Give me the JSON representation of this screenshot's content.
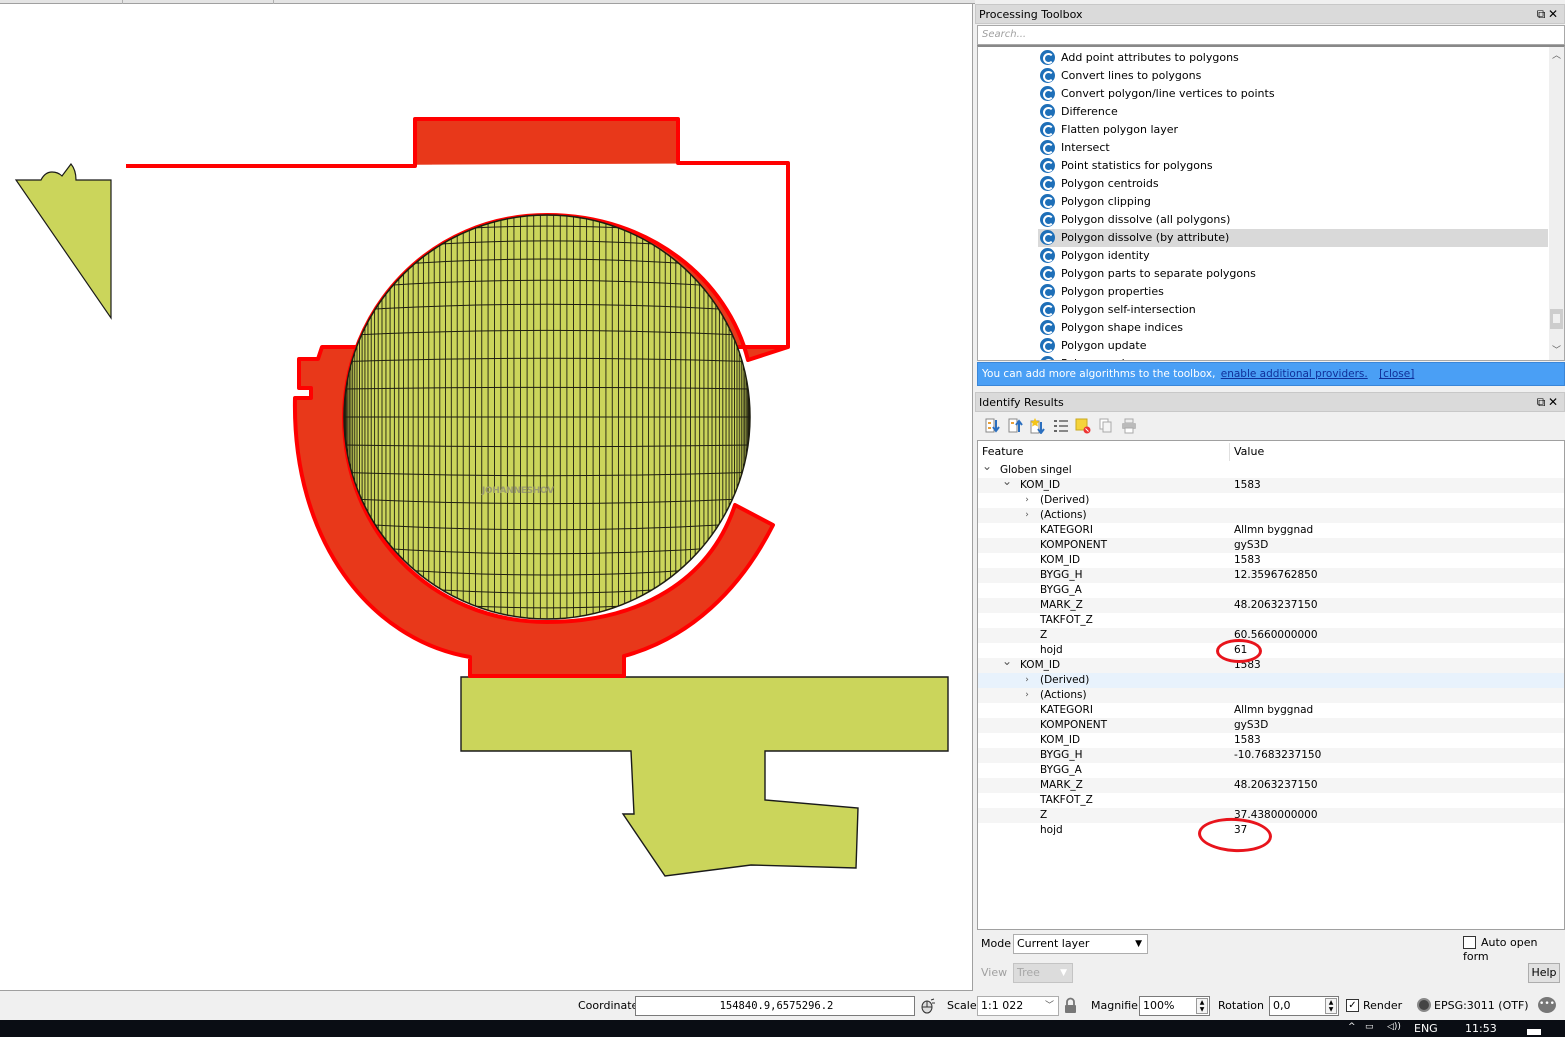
{
  "map": {
    "label": "JOHANNESHOV",
    "colors": {
      "polygon_fill": "#cbd55b",
      "selected_fill": "#e8381a",
      "selected_stroke": "#ff0000",
      "outline": "#1a1a1a"
    }
  },
  "processing_toolbox": {
    "title": "Processing Toolbox",
    "search_placeholder": "Search...",
    "items": [
      {
        "label": "Add point attributes to polygons"
      },
      {
        "label": "Convert lines to polygons"
      },
      {
        "label": "Convert polygon/line vertices to points"
      },
      {
        "label": "Difference"
      },
      {
        "label": "Flatten polygon layer"
      },
      {
        "label": "Intersect"
      },
      {
        "label": "Point statistics for polygons"
      },
      {
        "label": "Polygon centroids"
      },
      {
        "label": "Polygon clipping"
      },
      {
        "label": "Polygon dissolve (all polygons)"
      },
      {
        "label": "Polygon dissolve (by attribute)",
        "selected": true
      },
      {
        "label": "Polygon identity"
      },
      {
        "label": "Polygon parts to separate polygons"
      },
      {
        "label": "Polygon properties"
      },
      {
        "label": "Polygon self-intersection"
      },
      {
        "label": "Polygon shape indices"
      },
      {
        "label": "Polygon update"
      },
      {
        "label": "Polygon union"
      }
    ],
    "info_bar": {
      "text": "You can add more algorithms to the toolbox,",
      "link": "enable additional providers.",
      "close": "[close]"
    }
  },
  "identify_results": {
    "title": "Identify Results",
    "toolbar": [
      "expand-tree",
      "collapse-tree",
      "expand-new",
      "tree-view",
      "clear-highlight",
      "copy",
      "print"
    ],
    "columns": {
      "feature": "Feature",
      "value": "Value"
    },
    "layer": "Globen singel",
    "features": [
      {
        "id_label": "KOM_ID",
        "id_value": "1583",
        "derived": "(Derived)",
        "actions": "(Actions)",
        "attributes": [
          {
            "name": "KATEGORI",
            "value": "Allmn byggnad"
          },
          {
            "name": "KOMPONENT",
            "value": "gyS3D"
          },
          {
            "name": "KOM_ID",
            "value": "1583"
          },
          {
            "name": "BYGG_H",
            "value": "12.3596762850"
          },
          {
            "name": "BYGG_A",
            "value": ""
          },
          {
            "name": "MARK_Z",
            "value": "48.2063237150"
          },
          {
            "name": "TAKFOT_Z",
            "value": ""
          },
          {
            "name": "Z",
            "value": "60.5660000000"
          },
          {
            "name": "hojd",
            "value": "61"
          }
        ]
      },
      {
        "id_label": "KOM_ID",
        "id_value": "1583",
        "derived": "(Derived)",
        "actions": "(Actions)",
        "attributes": [
          {
            "name": "KATEGORI",
            "value": "Allmn byggnad"
          },
          {
            "name": "KOMPONENT",
            "value": "gyS3D"
          },
          {
            "name": "KOM_ID",
            "value": "1583"
          },
          {
            "name": "BYGG_H",
            "value": "-10.7683237150"
          },
          {
            "name": "BYGG_A",
            "value": ""
          },
          {
            "name": "MARK_Z",
            "value": "48.2063237150"
          },
          {
            "name": "TAKFOT_Z",
            "value": ""
          },
          {
            "name": "Z",
            "value": "37.4380000000"
          },
          {
            "name": "hojd",
            "value": "37"
          }
        ]
      }
    ],
    "mode_label": "Mode",
    "mode_value": "Current layer",
    "auto_open_label": "Auto open form",
    "auto_open_checked": false,
    "view_label": "View",
    "view_value": "Tree",
    "help_label": "Help"
  },
  "statusbar": {
    "coordinate_label": "Coordinate",
    "coordinate_value": "154840.9,6575296.2",
    "scale_label": "Scale",
    "scale_value": "1:1 022",
    "magnifier_label": "Magnifier",
    "magnifier_value": "100%",
    "rotation_label": "Rotation",
    "rotation_value": "0,0",
    "render_label": "Render",
    "render_checked": true,
    "crs_label": "EPSG:3011 (OTF)"
  },
  "taskbar": {
    "language": "ENG",
    "time": "11:53"
  }
}
